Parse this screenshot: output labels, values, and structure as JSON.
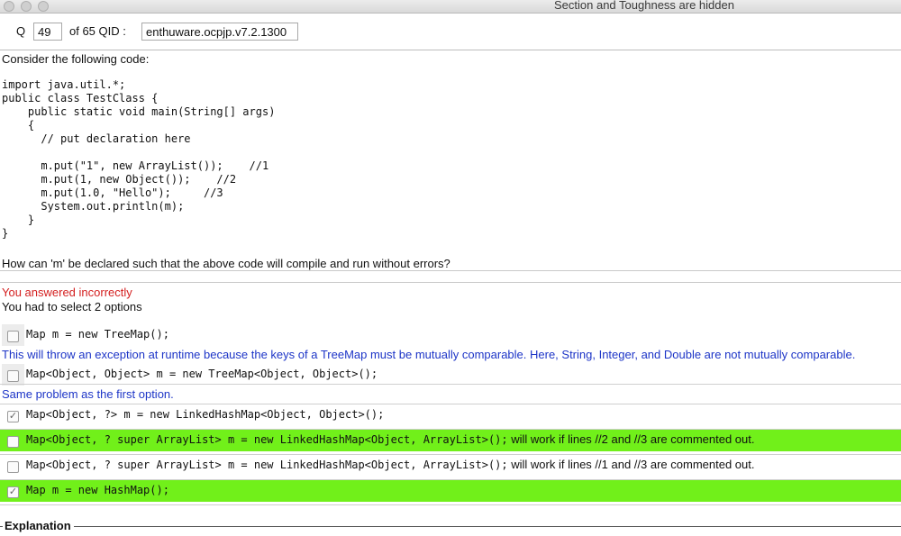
{
  "window": {
    "title": "Section and Toughness are hidden"
  },
  "question_bar": {
    "q_label": "Q",
    "q_number": "49",
    "of_label": "of 65 QID :",
    "qid": "enthuware.ocpjp.v7.2.1300"
  },
  "prompt": "Consider the following code:",
  "code_lines": [
    "import java.util.*;",
    "public class TestClass {",
    "    public static void main(String[] args)",
    "    {",
    "      // put declaration here",
    "",
    "      m.put(\"1\", new ArrayList());    //1",
    "      m.put(1, new Object());    //2",
    "      m.put(1.0, \"Hello\");     //3",
    "      System.out.println(m);",
    "    }",
    "}"
  ],
  "question": "How can 'm' be declared such that the above code will compile and run without errors?",
  "result": {
    "status": "You answered incorrectly",
    "instruction": "You had to select 2 options"
  },
  "options": [
    {
      "code": "Map m = new TreeMap();",
      "note": "",
      "checked": false,
      "correct": false,
      "comment": "This will throw an exception at runtime because the keys of a TreeMap must be mutually comparable. Here, String, Integer, and Double are not mutually comparable."
    },
    {
      "code": "Map<Object, Object> m = new TreeMap<Object, Object>();",
      "note": "",
      "checked": false,
      "correct": false,
      "comment": "Same problem as the first option."
    },
    {
      "code": "Map<Object, ?> m = new LinkedHashMap<Object, Object>();",
      "note": "",
      "checked": true,
      "correct": false,
      "comment": ""
    },
    {
      "code": "Map<Object, ? super ArrayList> m = new LinkedHashMap<Object, ArrayList>();",
      "note": " will work if lines //2 and //3 are commented out.",
      "checked": false,
      "correct": true,
      "comment": ""
    },
    {
      "code": "Map<Object, ? super ArrayList> m = new LinkedHashMap<Object, ArrayList>();",
      "note": " will work if lines //1 and //3 are commented out.",
      "checked": false,
      "correct": false,
      "comment": ""
    },
    {
      "code": "Map m = new HashMap();",
      "note": "",
      "checked": true,
      "correct": true,
      "comment": ""
    }
  ],
  "explanation_label": "Explanation",
  "colors": {
    "correct_highlight": "#71f01a",
    "wrong_text": "#d42020",
    "comment_text": "#1d35c7"
  },
  "check_glyph": "✓"
}
